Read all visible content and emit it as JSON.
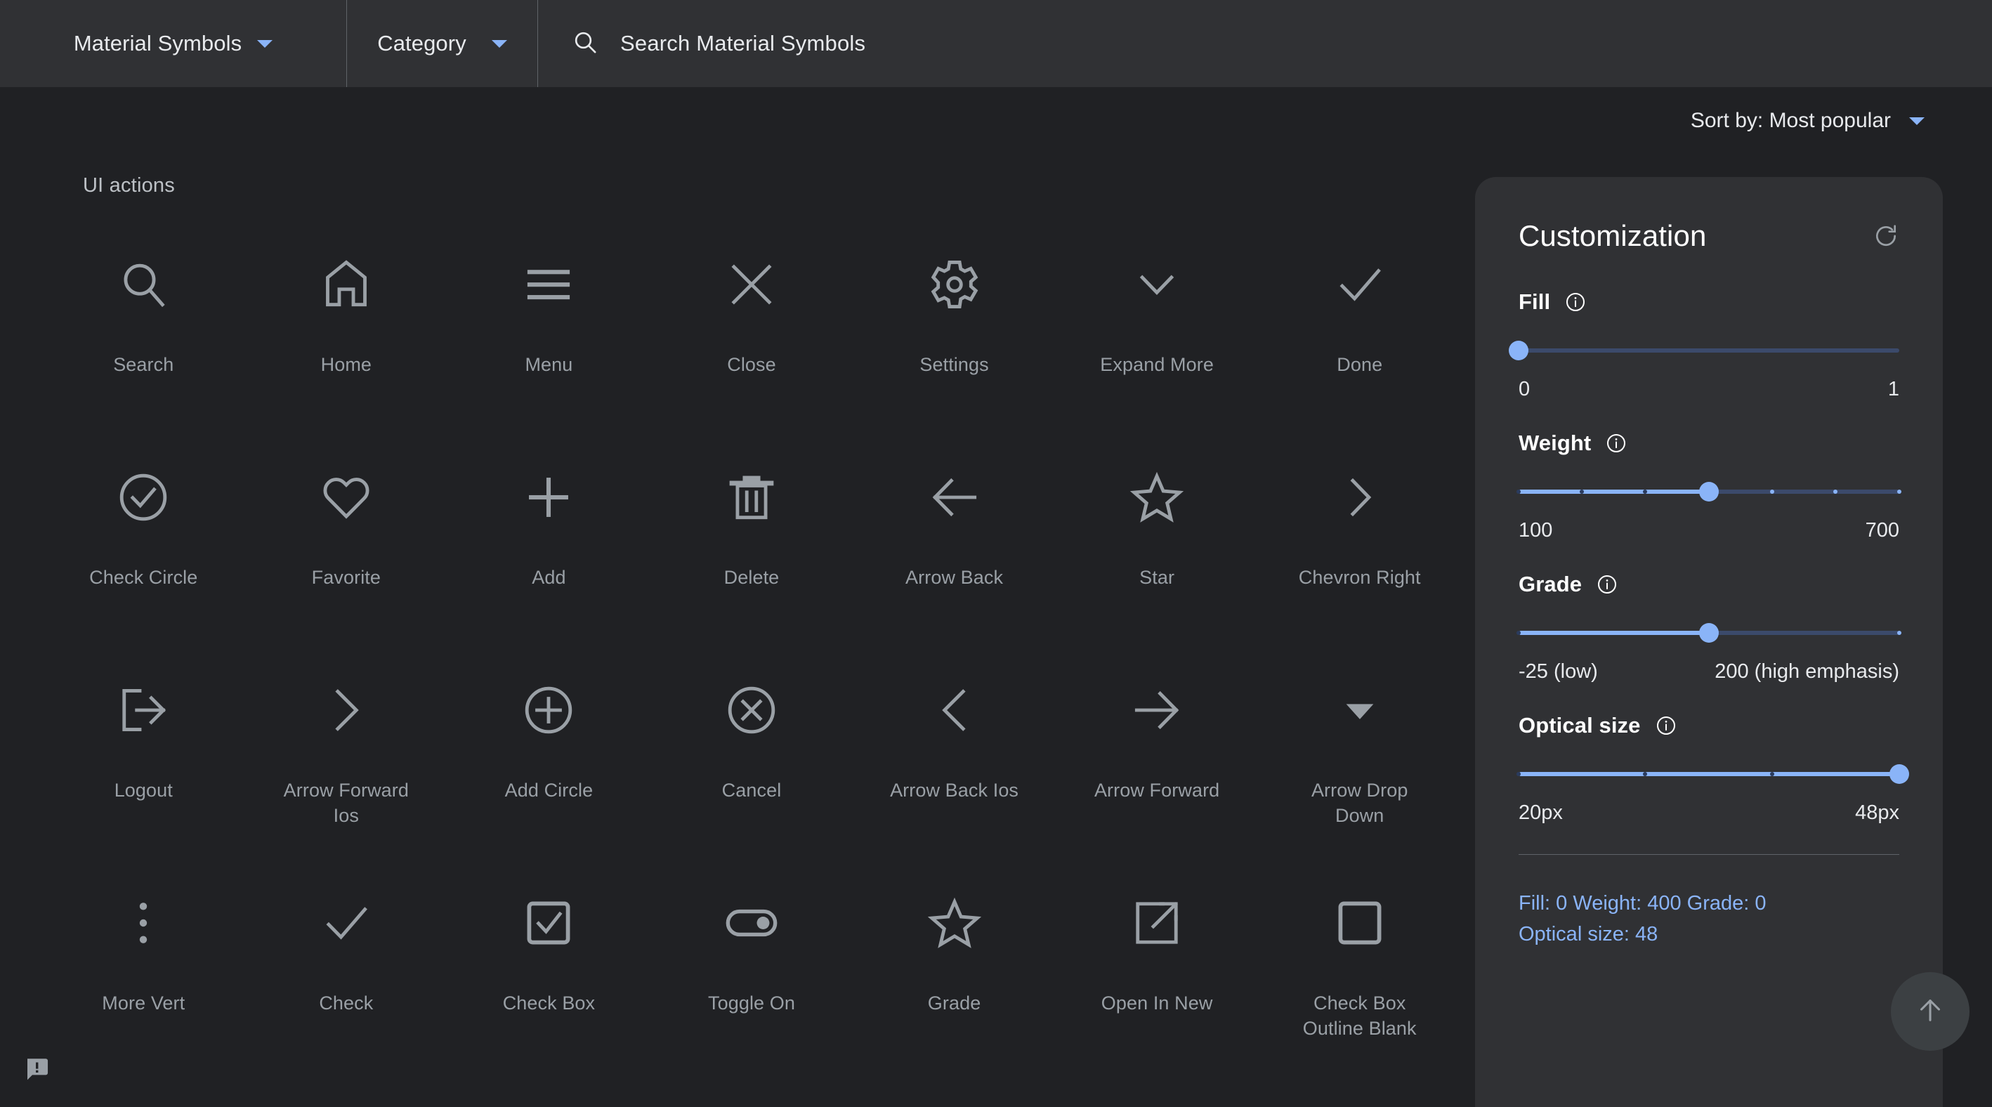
{
  "topbar": {
    "collection": {
      "label": "Material Symbols",
      "icon": "chevron-down-icon"
    },
    "category": {
      "label": "Category",
      "icon": "chevron-down-icon"
    },
    "search": {
      "icon": "search-icon",
      "value": "",
      "placeholder": "Search Material Symbols"
    }
  },
  "sort": {
    "label": "Sort by: Most popular",
    "icon": "chevron-down-icon"
  },
  "section": {
    "title": "UI actions"
  },
  "icons": [
    {
      "label": "Search",
      "icon": "search-icon"
    },
    {
      "label": "Home",
      "icon": "home-icon"
    },
    {
      "label": "Menu",
      "icon": "menu-icon"
    },
    {
      "label": "Close",
      "icon": "close-icon"
    },
    {
      "label": "Settings",
      "icon": "settings-gear-icon"
    },
    {
      "label": "Expand More",
      "icon": "expand-more-icon"
    },
    {
      "label": "Done",
      "icon": "done-check-icon"
    },
    {
      "label": "Check Circle",
      "icon": "check-circle-icon"
    },
    {
      "label": "Favorite",
      "icon": "favorite-heart-icon"
    },
    {
      "label": "Add",
      "icon": "add-plus-icon"
    },
    {
      "label": "Delete",
      "icon": "delete-trash-icon"
    },
    {
      "label": "Arrow Back",
      "icon": "arrow-back-icon"
    },
    {
      "label": "Star",
      "icon": "star-icon"
    },
    {
      "label": "Chevron Right",
      "icon": "chevron-right-icon"
    },
    {
      "label": "Logout",
      "icon": "logout-icon"
    },
    {
      "label": "Arrow Forward Ios",
      "icon": "arrow-forward-ios-icon"
    },
    {
      "label": "Add Circle",
      "icon": "add-circle-icon"
    },
    {
      "label": "Cancel",
      "icon": "cancel-icon"
    },
    {
      "label": "Arrow Back Ios",
      "icon": "arrow-back-ios-icon"
    },
    {
      "label": "Arrow Forward",
      "icon": "arrow-forward-icon"
    },
    {
      "label": "Arrow Drop Down",
      "icon": "arrow-drop-down-icon"
    },
    {
      "label": "More Vert",
      "icon": "more-vert-icon"
    },
    {
      "label": "Check",
      "icon": "check-icon"
    },
    {
      "label": "Check Box",
      "icon": "check-box-icon"
    },
    {
      "label": "Toggle On",
      "icon": "toggle-on-icon"
    },
    {
      "label": "Grade",
      "icon": "grade-star-icon"
    },
    {
      "label": "Open In New",
      "icon": "open-in-new-icon"
    },
    {
      "label": "Check Box Outline Blank",
      "icon": "check-box-outline-blank-icon"
    }
  ],
  "panel": {
    "title": "Customization",
    "reset_icon": "refresh-icon",
    "controls": [
      {
        "label": "Fill",
        "info_icon": "info-icon",
        "min_label": "0",
        "max_label": "1",
        "percent": 0,
        "ticks": []
      },
      {
        "label": "Weight",
        "info_icon": "info-icon",
        "min_label": "100",
        "max_label": "700",
        "percent": 50,
        "ticks": [
          0,
          16.6,
          33.3,
          50,
          66.6,
          83.3,
          100
        ]
      },
      {
        "label": "Grade",
        "info_icon": "info-icon",
        "min_label": "-25 (low)",
        "max_label": "200 (high emphasis)",
        "percent": 50,
        "ticks": [
          0,
          100
        ]
      },
      {
        "label": "Optical size",
        "info_icon": "info-icon",
        "min_label": "20px",
        "max_label": "48px",
        "percent": 100,
        "ticks": [
          0,
          33.3,
          66.6,
          100
        ]
      }
    ],
    "summary_line1": "Fill: 0 Weight: 400 Grade: 0",
    "summary_line2": "Optical size: 48"
  },
  "fab": {
    "icon": "arrow-upward-icon"
  },
  "feedback": {
    "icon": "feedback-icon"
  },
  "colors": {
    "background": "#202124",
    "surface": "#303134",
    "accent": "#8ab4f8",
    "icon_gray": "#9aa0a6",
    "text_primary": "#e8eaed"
  }
}
